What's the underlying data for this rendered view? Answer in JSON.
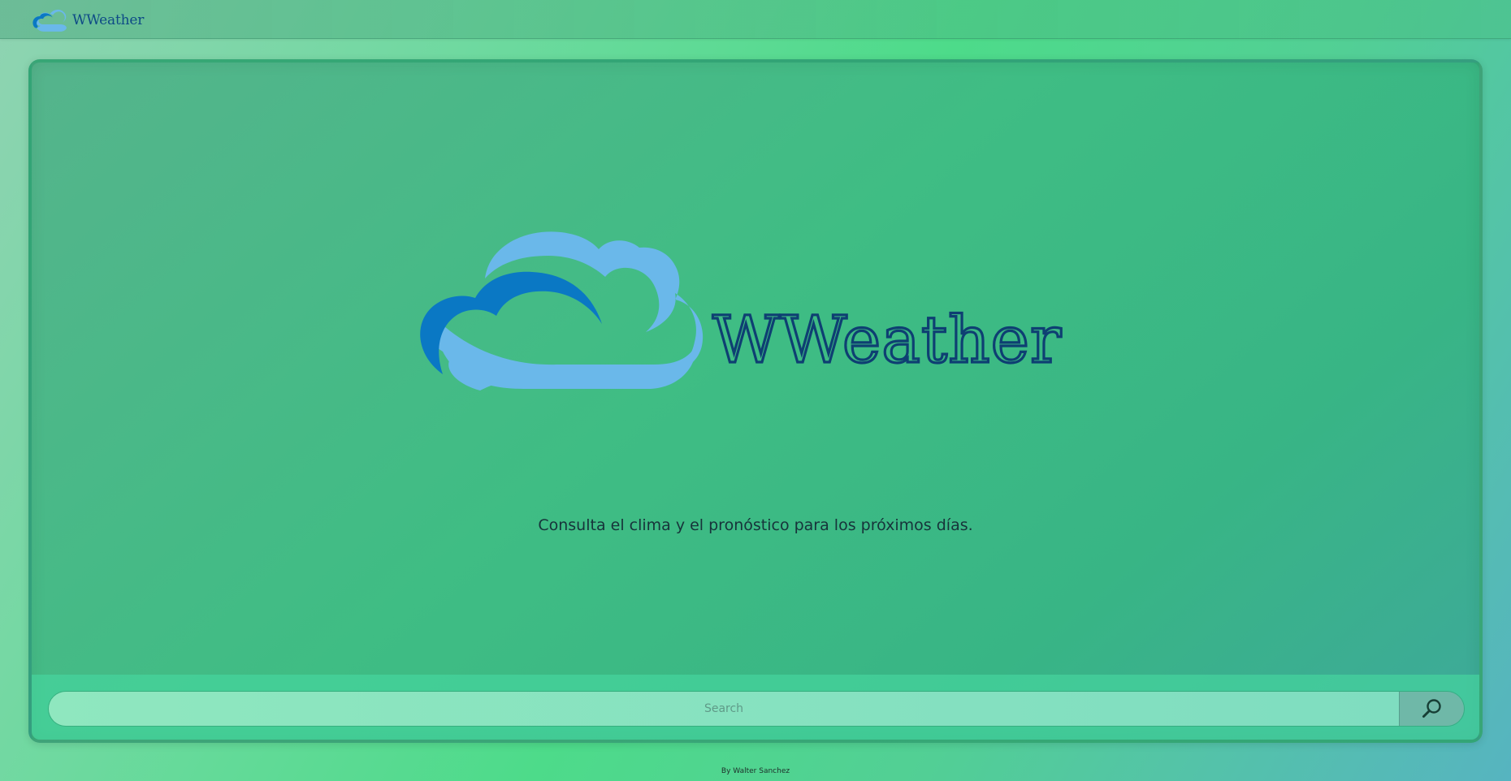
{
  "navbar": {
    "brand_text": "WWeather",
    "brand_icon": "cloud-icon"
  },
  "hero": {
    "logo_text": "WWeather",
    "logo_icon": "cloud-icon",
    "tagline": "Consulta el clima y el pronóstico para los próximos días."
  },
  "search": {
    "placeholder": "Search",
    "value": "",
    "button_icon": "search-icon"
  },
  "footer": {
    "credit": "By Walter Sanchez"
  },
  "colors": {
    "logo_text": "#0e3f72",
    "cloud_light": "#6ab8ea",
    "cloud_dark": "#0a78c4"
  }
}
